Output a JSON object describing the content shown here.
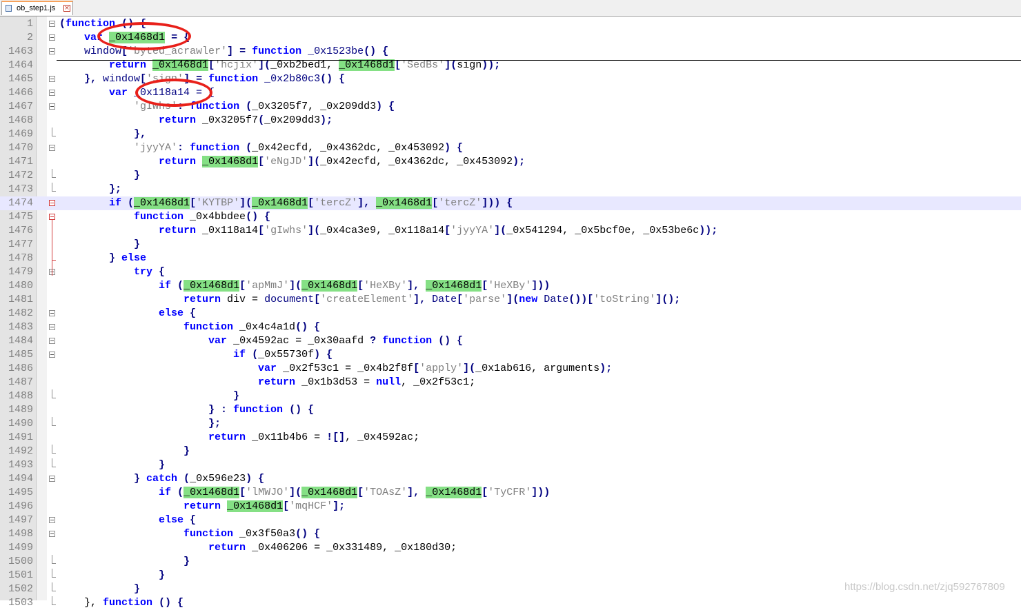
{
  "tab": {
    "title": "ob_step1.js"
  },
  "watermark": "https://blog.csdn.net/zjq592767809",
  "lines": [
    {
      "n": "1",
      "fold": "box",
      "tokens": [
        {
          "t": "(",
          "c": "p"
        },
        {
          "t": "function",
          "c": "k"
        },
        {
          "t": " () {",
          "c": "p"
        }
      ]
    },
    {
      "n": "2",
      "fold": "plus",
      "tokens": [
        {
          "t": "    "
        },
        {
          "t": "var",
          "c": "k"
        },
        {
          "t": " "
        },
        {
          "t": "_0x1468d1",
          "c": "h"
        },
        {
          "t": " = {",
          "c": "p"
        }
      ]
    },
    {
      "n": "1463",
      "fold": "box",
      "tokens": [
        {
          "t": "    window",
          "c": "d"
        },
        {
          "t": "[",
          "c": "p"
        },
        {
          "t": "'byted_acrawler'",
          "c": "s"
        },
        {
          "t": "] = ",
          "c": "p"
        },
        {
          "t": "function",
          "c": "k"
        },
        {
          "t": " _0x1523be",
          "c": "d"
        },
        {
          "t": "() {",
          "c": "p"
        }
      ]
    },
    {
      "n": "1464",
      "fold": "line",
      "tokens": [
        {
          "t": "        "
        },
        {
          "t": "return",
          "c": "k"
        },
        {
          "t": " "
        },
        {
          "t": "_0x1468d1",
          "c": "h"
        },
        {
          "t": "[",
          "c": "p"
        },
        {
          "t": "'hcjix'",
          "c": "s"
        },
        {
          "t": "](",
          "c": "p"
        },
        {
          "t": "_0xb2bed1, "
        },
        {
          "t": "_0x1468d1",
          "c": "h"
        },
        {
          "t": "[",
          "c": "p"
        },
        {
          "t": "'SedBs'",
          "c": "s"
        },
        {
          "t": "](",
          "c": "p"
        },
        {
          "t": "sign"
        },
        {
          "t": "));",
          "c": "p"
        }
      ]
    },
    {
      "n": "1465",
      "fold": "box",
      "tokens": [
        {
          "t": "    }, ",
          "c": "p"
        },
        {
          "t": "window",
          "c": "d"
        },
        {
          "t": "[",
          "c": "p"
        },
        {
          "t": "'sign'",
          "c": "s"
        },
        {
          "t": "] = ",
          "c": "p"
        },
        {
          "t": "function",
          "c": "k"
        },
        {
          "t": " _0x2b80c3",
          "c": "d"
        },
        {
          "t": "() {",
          "c": "p"
        }
      ]
    },
    {
      "n": "1466",
      "fold": "box",
      "tokens": [
        {
          "t": "        "
        },
        {
          "t": "var",
          "c": "k"
        },
        {
          "t": " _0x118a14 = {",
          "c": "d"
        }
      ]
    },
    {
      "n": "1467",
      "fold": "box",
      "tokens": [
        {
          "t": "            "
        },
        {
          "t": "'gIwhs'",
          "c": "s"
        },
        {
          "t": ": ",
          "c": "p"
        },
        {
          "t": "function",
          "c": "k"
        },
        {
          "t": " (",
          "c": "p"
        },
        {
          "t": "_0x3205f7, _0x209dd3"
        },
        {
          "t": ") {",
          "c": "p"
        }
      ]
    },
    {
      "n": "1468",
      "fold": "line",
      "tokens": [
        {
          "t": "                "
        },
        {
          "t": "return",
          "c": "k"
        },
        {
          "t": " _0x3205f7"
        },
        {
          "t": "(",
          "c": "p"
        },
        {
          "t": "_0x209dd3"
        },
        {
          "t": ");",
          "c": "p"
        }
      ]
    },
    {
      "n": "1469",
      "fold": "end",
      "tokens": [
        {
          "t": "            },",
          "c": "p"
        }
      ]
    },
    {
      "n": "1470",
      "fold": "box",
      "tokens": [
        {
          "t": "            "
        },
        {
          "t": "'jyyYA'",
          "c": "s"
        },
        {
          "t": ": ",
          "c": "p"
        },
        {
          "t": "function",
          "c": "k"
        },
        {
          "t": " (",
          "c": "p"
        },
        {
          "t": "_0x42ecfd, _0x4362dc, _0x453092"
        },
        {
          "t": ") {",
          "c": "p"
        }
      ]
    },
    {
      "n": "1471",
      "fold": "line",
      "tokens": [
        {
          "t": "                "
        },
        {
          "t": "return",
          "c": "k"
        },
        {
          "t": " "
        },
        {
          "t": "_0x1468d1",
          "c": "h"
        },
        {
          "t": "[",
          "c": "p"
        },
        {
          "t": "'eNgJD'",
          "c": "s"
        },
        {
          "t": "](",
          "c": "p"
        },
        {
          "t": "_0x42ecfd, _0x4362dc, _0x453092"
        },
        {
          "t": ");",
          "c": "p"
        }
      ]
    },
    {
      "n": "1472",
      "fold": "end",
      "tokens": [
        {
          "t": "            }",
          "c": "p"
        }
      ]
    },
    {
      "n": "1473",
      "fold": "end",
      "tokens": [
        {
          "t": "        };",
          "c": "p"
        }
      ]
    },
    {
      "n": "1474",
      "fold": "redbox",
      "cur": true,
      "tokens": [
        {
          "t": "        "
        },
        {
          "t": "if",
          "c": "k"
        },
        {
          "t": " (",
          "c": "p"
        },
        {
          "t": "_0x1468d1",
          "c": "h"
        },
        {
          "t": "[",
          "c": "p"
        },
        {
          "t": "'KYTBP'",
          "c": "s"
        },
        {
          "t": "](",
          "c": "p"
        },
        {
          "t": "_0x1468d1",
          "c": "h"
        },
        {
          "t": "[",
          "c": "p"
        },
        {
          "t": "'tercZ'",
          "c": "s"
        },
        {
          "t": "], ",
          "c": "p"
        },
        {
          "t": "_0x1468d1",
          "c": "h"
        },
        {
          "t": "[",
          "c": "p"
        },
        {
          "t": "'tercZ'",
          "c": "s"
        },
        {
          "t": "])) {",
          "c": "p"
        }
      ]
    },
    {
      "n": "1475",
      "fold": "redbox",
      "tokens": [
        {
          "t": "            "
        },
        {
          "t": "function",
          "c": "k"
        },
        {
          "t": " _0x4bbdee"
        },
        {
          "t": "() {",
          "c": "p"
        }
      ]
    },
    {
      "n": "1476",
      "fold": "none",
      "tokens": [
        {
          "t": "                "
        },
        {
          "t": "return",
          "c": "k"
        },
        {
          "t": " _0x118a14"
        },
        {
          "t": "[",
          "c": "p"
        },
        {
          "t": "'gIwhs'",
          "c": "s"
        },
        {
          "t": "](",
          "c": "p"
        },
        {
          "t": "_0x4ca3e9, _0x118a14"
        },
        {
          "t": "[",
          "c": "p"
        },
        {
          "t": "'jyyYA'",
          "c": "s"
        },
        {
          "t": "](",
          "c": "p"
        },
        {
          "t": "_0x541294, _0x5bcf0e, _0x53be6c"
        },
        {
          "t": "));",
          "c": "p"
        }
      ]
    },
    {
      "n": "1477",
      "fold": "none",
      "tokens": [
        {
          "t": "            }",
          "c": "p"
        }
      ]
    },
    {
      "n": "1478",
      "fold": "redend",
      "tokens": [
        {
          "t": "        } ",
          "c": "p"
        },
        {
          "t": "else",
          "c": "k"
        }
      ]
    },
    {
      "n": "1479",
      "fold": "box",
      "tokens": [
        {
          "t": "            "
        },
        {
          "t": "try",
          "c": "k"
        },
        {
          "t": " {",
          "c": "p"
        }
      ]
    },
    {
      "n": "1480",
      "fold": "line",
      "tokens": [
        {
          "t": "                "
        },
        {
          "t": "if",
          "c": "k"
        },
        {
          "t": " (",
          "c": "p"
        },
        {
          "t": "_0x1468d1",
          "c": "h"
        },
        {
          "t": "[",
          "c": "p"
        },
        {
          "t": "'apMmJ'",
          "c": "s"
        },
        {
          "t": "](",
          "c": "p"
        },
        {
          "t": "_0x1468d1",
          "c": "h"
        },
        {
          "t": "[",
          "c": "p"
        },
        {
          "t": "'HeXBy'",
          "c": "s"
        },
        {
          "t": "], ",
          "c": "p"
        },
        {
          "t": "_0x1468d1",
          "c": "h"
        },
        {
          "t": "[",
          "c": "p"
        },
        {
          "t": "'HeXBy'",
          "c": "s"
        },
        {
          "t": "]))",
          "c": "p"
        }
      ]
    },
    {
      "n": "1481",
      "fold": "line",
      "tokens": [
        {
          "t": "                    "
        },
        {
          "t": "return",
          "c": "k"
        },
        {
          "t": " div = "
        },
        {
          "t": "document",
          "c": "d"
        },
        {
          "t": "[",
          "c": "p"
        },
        {
          "t": "'createElement'",
          "c": "s"
        },
        {
          "t": "], ",
          "c": "p"
        },
        {
          "t": "Date",
          "c": "d"
        },
        {
          "t": "[",
          "c": "p"
        },
        {
          "t": "'parse'",
          "c": "s"
        },
        {
          "t": "](",
          "c": "p"
        },
        {
          "t": "new",
          "c": "k"
        },
        {
          "t": " "
        },
        {
          "t": "Date",
          "c": "d"
        },
        {
          "t": "())[",
          "c": "p"
        },
        {
          "t": "'toString'",
          "c": "s"
        },
        {
          "t": "]();",
          "c": "p"
        }
      ]
    },
    {
      "n": "1482",
      "fold": "box",
      "tokens": [
        {
          "t": "                "
        },
        {
          "t": "else",
          "c": "k"
        },
        {
          "t": " {",
          "c": "p"
        }
      ]
    },
    {
      "n": "1483",
      "fold": "box",
      "tokens": [
        {
          "t": "                    "
        },
        {
          "t": "function",
          "c": "k"
        },
        {
          "t": " _0x4c4a1d"
        },
        {
          "t": "() {",
          "c": "p"
        }
      ]
    },
    {
      "n": "1484",
      "fold": "box",
      "tokens": [
        {
          "t": "                        "
        },
        {
          "t": "var",
          "c": "k"
        },
        {
          "t": " _0x4592ac = _0x30aafd "
        },
        {
          "t": "? ",
          "c": "p"
        },
        {
          "t": "function",
          "c": "k"
        },
        {
          "t": " () {",
          "c": "p"
        }
      ]
    },
    {
      "n": "1485",
      "fold": "box",
      "tokens": [
        {
          "t": "                            "
        },
        {
          "t": "if",
          "c": "k"
        },
        {
          "t": " (",
          "c": "p"
        },
        {
          "t": "_0x55730f"
        },
        {
          "t": ") {",
          "c": "p"
        }
      ]
    },
    {
      "n": "1486",
      "fold": "line",
      "tokens": [
        {
          "t": "                                "
        },
        {
          "t": "var",
          "c": "k"
        },
        {
          "t": " _0x2f53c1 = _0x4b2f8f"
        },
        {
          "t": "[",
          "c": "p"
        },
        {
          "t": "'apply'",
          "c": "s"
        },
        {
          "t": "](",
          "c": "p"
        },
        {
          "t": "_0x1ab616, arguments"
        },
        {
          "t": ");",
          "c": "p"
        }
      ]
    },
    {
      "n": "1487",
      "fold": "line",
      "tokens": [
        {
          "t": "                                "
        },
        {
          "t": "return",
          "c": "k"
        },
        {
          "t": " _0x1b3d53 = "
        },
        {
          "t": "null",
          "c": "k"
        },
        {
          "t": ", _0x2f53c1;"
        }
      ]
    },
    {
      "n": "1488",
      "fold": "end",
      "tokens": [
        {
          "t": "                            }",
          "c": "p"
        }
      ]
    },
    {
      "n": "1489",
      "fold": "line",
      "tokens": [
        {
          "t": "                        } : ",
          "c": "p"
        },
        {
          "t": "function",
          "c": "k"
        },
        {
          "t": " () {",
          "c": "p"
        }
      ]
    },
    {
      "n": "1490",
      "fold": "end",
      "tokens": [
        {
          "t": "                        };",
          "c": "p"
        }
      ]
    },
    {
      "n": "1491",
      "fold": "line",
      "tokens": [
        {
          "t": "                        "
        },
        {
          "t": "return",
          "c": "k"
        },
        {
          "t": " _0x11b4b6 = "
        },
        {
          "t": "![]",
          "c": "p"
        },
        {
          "t": ", _0x4592ac;"
        }
      ]
    },
    {
      "n": "1492",
      "fold": "end",
      "tokens": [
        {
          "t": "                    }",
          "c": "p"
        }
      ]
    },
    {
      "n": "1493",
      "fold": "end",
      "tokens": [
        {
          "t": "                }",
          "c": "p"
        }
      ]
    },
    {
      "n": "1494",
      "fold": "box",
      "tokens": [
        {
          "t": "            } ",
          "c": "p"
        },
        {
          "t": "catch",
          "c": "k"
        },
        {
          "t": " (",
          "c": "p"
        },
        {
          "t": "_0x596e23"
        },
        {
          "t": ") {",
          "c": "p"
        }
      ]
    },
    {
      "n": "1495",
      "fold": "line",
      "tokens": [
        {
          "t": "                "
        },
        {
          "t": "if",
          "c": "k"
        },
        {
          "t": " (",
          "c": "p"
        },
        {
          "t": "_0x1468d1",
          "c": "h"
        },
        {
          "t": "[",
          "c": "p"
        },
        {
          "t": "'lMWJO'",
          "c": "s"
        },
        {
          "t": "](",
          "c": "p"
        },
        {
          "t": "_0x1468d1",
          "c": "h"
        },
        {
          "t": "[",
          "c": "p"
        },
        {
          "t": "'TOAsZ'",
          "c": "s"
        },
        {
          "t": "], ",
          "c": "p"
        },
        {
          "t": "_0x1468d1",
          "c": "h"
        },
        {
          "t": "[",
          "c": "p"
        },
        {
          "t": "'TyCFR'",
          "c": "s"
        },
        {
          "t": "]))",
          "c": "p"
        }
      ]
    },
    {
      "n": "1496",
      "fold": "line",
      "tokens": [
        {
          "t": "                    "
        },
        {
          "t": "return",
          "c": "k"
        },
        {
          "t": " "
        },
        {
          "t": "_0x1468d1",
          "c": "h"
        },
        {
          "t": "[",
          "c": "p"
        },
        {
          "t": "'mqHCF'",
          "c": "s"
        },
        {
          "t": "];",
          "c": "p"
        }
      ]
    },
    {
      "n": "1497",
      "fold": "box",
      "tokens": [
        {
          "t": "                "
        },
        {
          "t": "else",
          "c": "k"
        },
        {
          "t": " {",
          "c": "p"
        }
      ]
    },
    {
      "n": "1498",
      "fold": "box",
      "tokens": [
        {
          "t": "                    "
        },
        {
          "t": "function",
          "c": "k"
        },
        {
          "t": " _0x3f50a3"
        },
        {
          "t": "() {",
          "c": "p"
        }
      ]
    },
    {
      "n": "1499",
      "fold": "line",
      "tokens": [
        {
          "t": "                        "
        },
        {
          "t": "return",
          "c": "k"
        },
        {
          "t": " _0x406206 = _0x331489, _0x180d30;"
        }
      ]
    },
    {
      "n": "1500",
      "fold": "end",
      "tokens": [
        {
          "t": "                    }",
          "c": "p"
        }
      ]
    },
    {
      "n": "1501",
      "fold": "end",
      "tokens": [
        {
          "t": "                }",
          "c": "p"
        }
      ]
    },
    {
      "n": "1502",
      "fold": "end",
      "tokens": [
        {
          "t": "            }",
          "c": "p"
        }
      ]
    },
    {
      "n": "1503",
      "fold": "end",
      "tokens": [
        {
          "t": "    }, "
        },
        {
          "t": "function",
          "c": "k"
        },
        {
          "t": " () {",
          "c": "p"
        }
      ]
    }
  ]
}
